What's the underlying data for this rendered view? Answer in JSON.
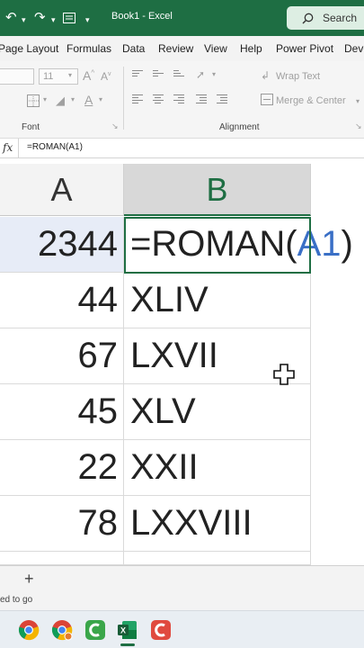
{
  "titlebar": {
    "title": "Book1 - Excel",
    "search_label": "Search"
  },
  "menu": {
    "tabs": [
      "Page Layout",
      "Formulas",
      "Data",
      "Review",
      "View",
      "Help",
      "Power Pivot",
      "Deve"
    ]
  },
  "ribbon": {
    "font_size": "11",
    "font_group_label": "Font",
    "alignment_group_label": "Alignment",
    "wrap_text_label": "Wrap Text",
    "merge_center_label": "Merge & Center"
  },
  "formula_bar": {
    "fx_label": "fx",
    "formula": "=ROMAN(A1)"
  },
  "columns": [
    "A",
    "B"
  ],
  "rows": [
    {
      "a": "2344",
      "b_prefix": "=ROMAN(",
      "b_ref": "A1",
      "b_suffix": ")"
    },
    {
      "a": "44",
      "b": "XLIV"
    },
    {
      "a": "67",
      "b": "LXVII"
    },
    {
      "a": "45",
      "b": "XLV"
    },
    {
      "a": "22",
      "b": "XXII"
    },
    {
      "a": "78",
      "b": "LXXVIII"
    }
  ],
  "sheet_tabs": {
    "add_label": "+"
  },
  "status": {
    "text": "ed to go"
  },
  "colors": {
    "excel_green": "#1e6e43",
    "reference_blue": "#3a6fc6"
  }
}
